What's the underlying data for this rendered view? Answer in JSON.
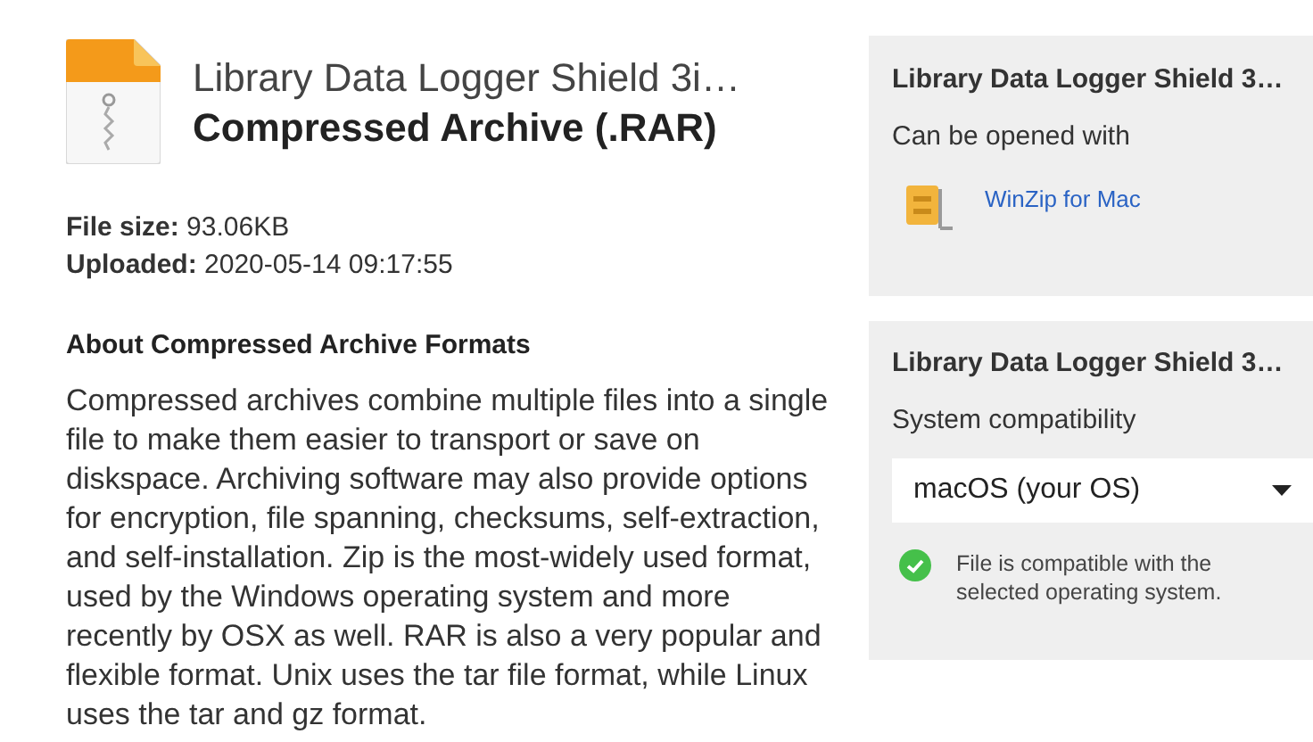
{
  "file": {
    "name": "Library Data Logger Shield 3i…",
    "type": "Compressed Archive (.RAR)",
    "details": [
      {
        "label": "File size:",
        "value": "93.06KB"
      },
      {
        "label": "Uploaded:",
        "value": "2020-05-14 09:17:55"
      }
    ]
  },
  "about": {
    "heading": "About Compressed Archive Formats",
    "text": "Compressed archives combine multiple files into a single file to make them easier to transport or save on diskspace. Archiving software may also provide options for encryption, file spanning, checksums, self-extraction, and self-installation. Zip is the most-widely used format, used by the Windows operating system and more recently by OSX as well. RAR is also a very popular and flexible format. Unix uses the tar file format, while Linux uses the tar and gz format."
  },
  "open_with": {
    "title": "Library Data Logger Shield 3…",
    "subtitle": "Can be opened with",
    "apps": [
      "WinZip for Mac"
    ]
  },
  "compatibility": {
    "title": "Library Data Logger Shield 3…",
    "subtitle": "System compatibility",
    "os": "macOS (your OS)",
    "compatible": true,
    "message": "File is compatible with the selected operating system."
  }
}
